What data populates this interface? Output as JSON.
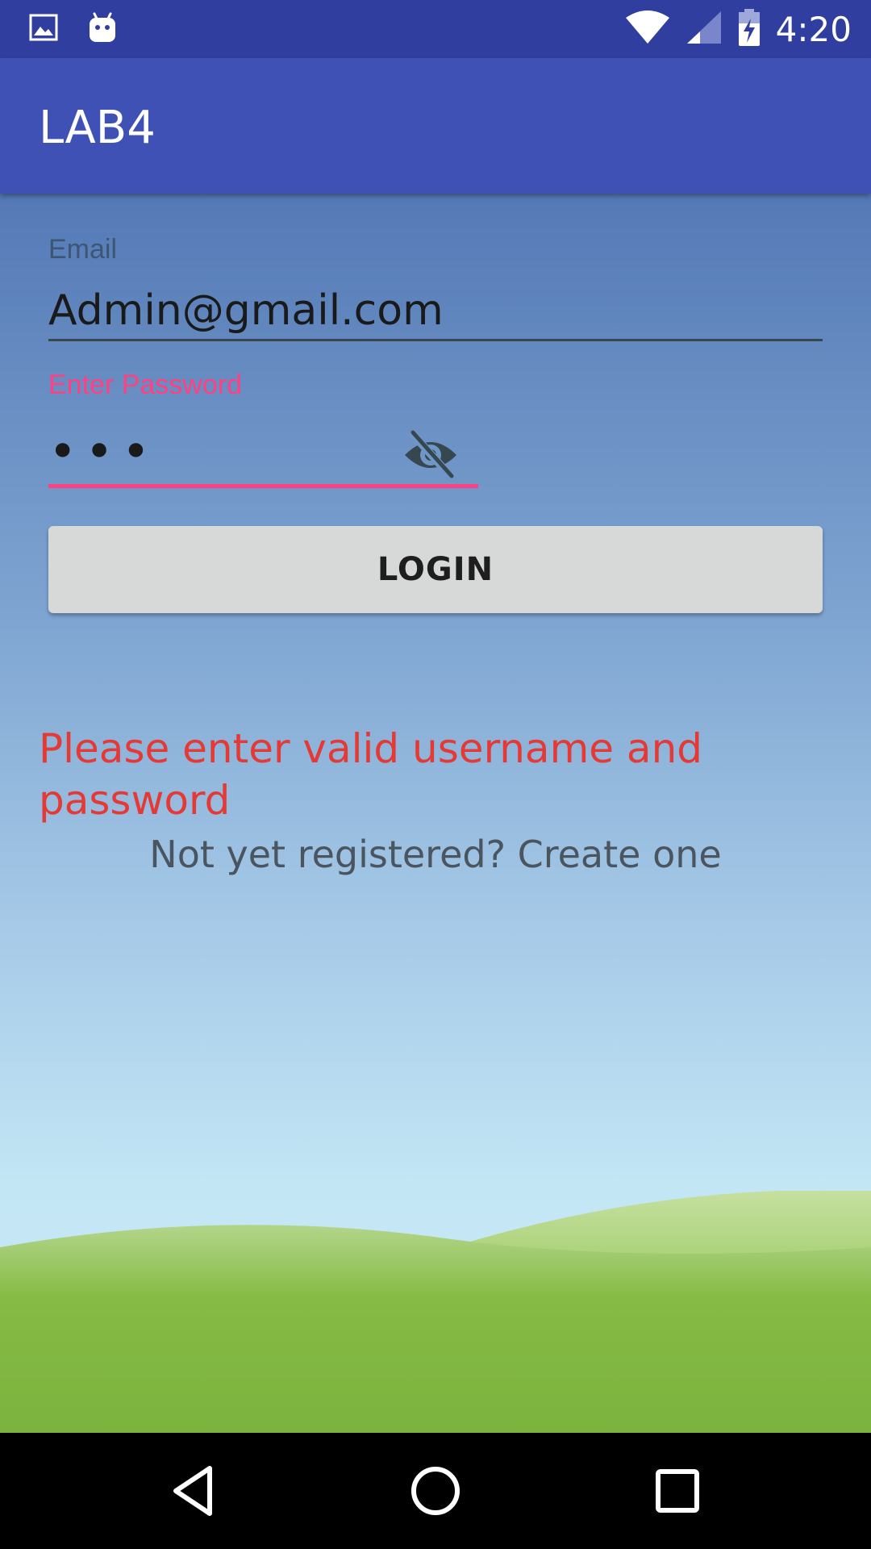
{
  "status_bar": {
    "time": "4:20",
    "icons": [
      "image-icon",
      "android-icon",
      "wifi-icon",
      "signal-icon",
      "battery-charging-icon"
    ]
  },
  "app_bar": {
    "title": "LAB4"
  },
  "form": {
    "email_label": "Email",
    "email_value": "Admin@gmail.com",
    "password_label": "Enter Password",
    "password_value": "•••",
    "password_toggle_icon": "eye-off-icon",
    "login_label": "LOGIN"
  },
  "error_message": "Please enter valid username and password",
  "register_link": "Not yet registered? Create one",
  "nav_bar": {
    "icons": [
      "back-icon",
      "home-icon",
      "recents-icon"
    ]
  },
  "colors": {
    "status_bar": "#303f9f",
    "app_bar": "#3f51b5",
    "accent": "#ff4081",
    "error": "#e53935",
    "button": "#d7d9d8"
  }
}
